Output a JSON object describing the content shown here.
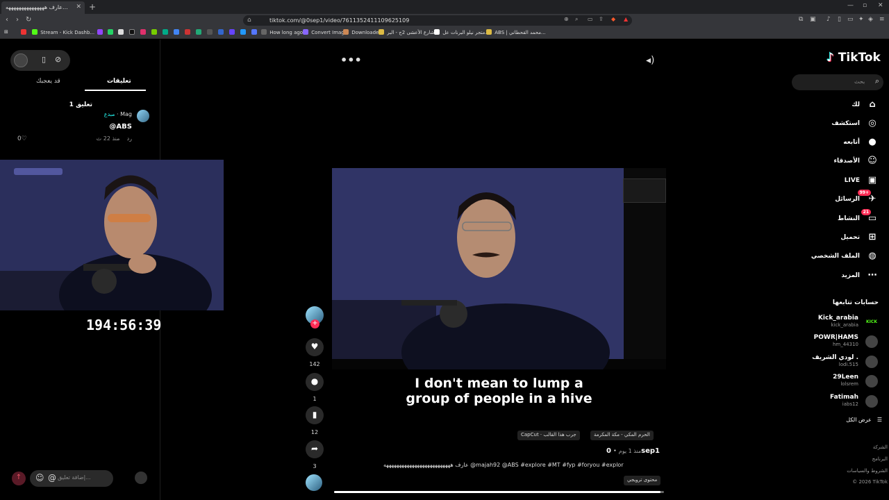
{
  "browser": {
    "tab_title": "عارف هههههههههههههههه...",
    "url": "tiktok.com/@0sep1/video/7611352411109625109",
    "bookmarks": [
      "Stream - Kick Dashb...",
      "How long ago",
      "Convert Image",
      "Downloader",
      "شارع الأعشى 2ج - البر...",
      "متجر نيلو البرنات عل...",
      "ABS | محمد القحطاني..."
    ]
  },
  "comments_panel": {
    "tab_comments": "تعليقات",
    "tab_you_may_like": "قد يعجبك",
    "count": "1 تعليق",
    "comment": {
      "user": "Mag",
      "badge": "مبدع",
      "text": "@ABS",
      "time": "منذ 22 ث",
      "reply": "رد",
      "likes": "0"
    },
    "input_placeholder": "إضافة تعليق..."
  },
  "stream": {
    "timer": "194:56:39"
  },
  "video": {
    "caption_line1": "I don't mean to lump a",
    "caption_line2": "group of people in a hive",
    "likes": "142",
    "comments": "1",
    "saves": "12",
    "shares": "3",
    "chip_location": "الحرم المكي - مكة المكرمة",
    "chip_capcut": "CapCut · جرب هذا القالب",
    "author": "0sep1",
    "time": "منذ 1 يوم",
    "description": "عارف ههههههههههههههههههههههههههه @majah92 @ABS  #explore #MT #fyp #foryou #explor",
    "promo": "محتوى ترويجي",
    "progress": 0.99
  },
  "sidebar": {
    "logo": "TikTok",
    "search_placeholder": "بحث",
    "nav": [
      {
        "label": "لك",
        "icon": "home-icon",
        "glyph": "⌂"
      },
      {
        "label": "استكشف",
        "icon": "compass-icon",
        "glyph": "◎"
      },
      {
        "label": "أتابعه",
        "icon": "following-avatar-icon",
        "glyph": "●"
      },
      {
        "label": "الأصدقاء",
        "icon": "friends-icon",
        "glyph": "☺"
      },
      {
        "label": "LIVE",
        "icon": "live-icon",
        "glyph": "▣"
      },
      {
        "label": "الرسائل",
        "icon": "messages-icon",
        "glyph": "✈",
        "badge": "99+"
      },
      {
        "label": "النشاط",
        "icon": "activity-icon",
        "glyph": "▭",
        "badge": "21"
      },
      {
        "label": "تحميل",
        "icon": "upload-icon",
        "glyph": "⊞"
      },
      {
        "label": "الملف الشخصي",
        "icon": "profile-icon",
        "glyph": "◍"
      },
      {
        "label": "المزيد",
        "icon": "more-icon",
        "glyph": "⋯"
      }
    ],
    "following_title": "حسابات تتابعها",
    "accounts": [
      {
        "name": "Kick_arabia",
        "handle": "kick_arabia"
      },
      {
        "name": "POWR|HAMS",
        "handle": "hm_44310"
      },
      {
        "name": "لودي الشريف .",
        "handle": "lodi.515"
      },
      {
        "name": "29Leen",
        "handle": "lolsrem"
      },
      {
        "name": "Fatimah",
        "handle": "iabs12"
      }
    ],
    "see_all": "عرض الكل",
    "footer": [
      "الشركة",
      "البرنامج",
      "الشروط والسياسات",
      "© 2026 TikTok"
    ]
  },
  "colors": {
    "accent": "#fe2c55",
    "cyan": "#25f4ee",
    "bg": "#000000"
  }
}
